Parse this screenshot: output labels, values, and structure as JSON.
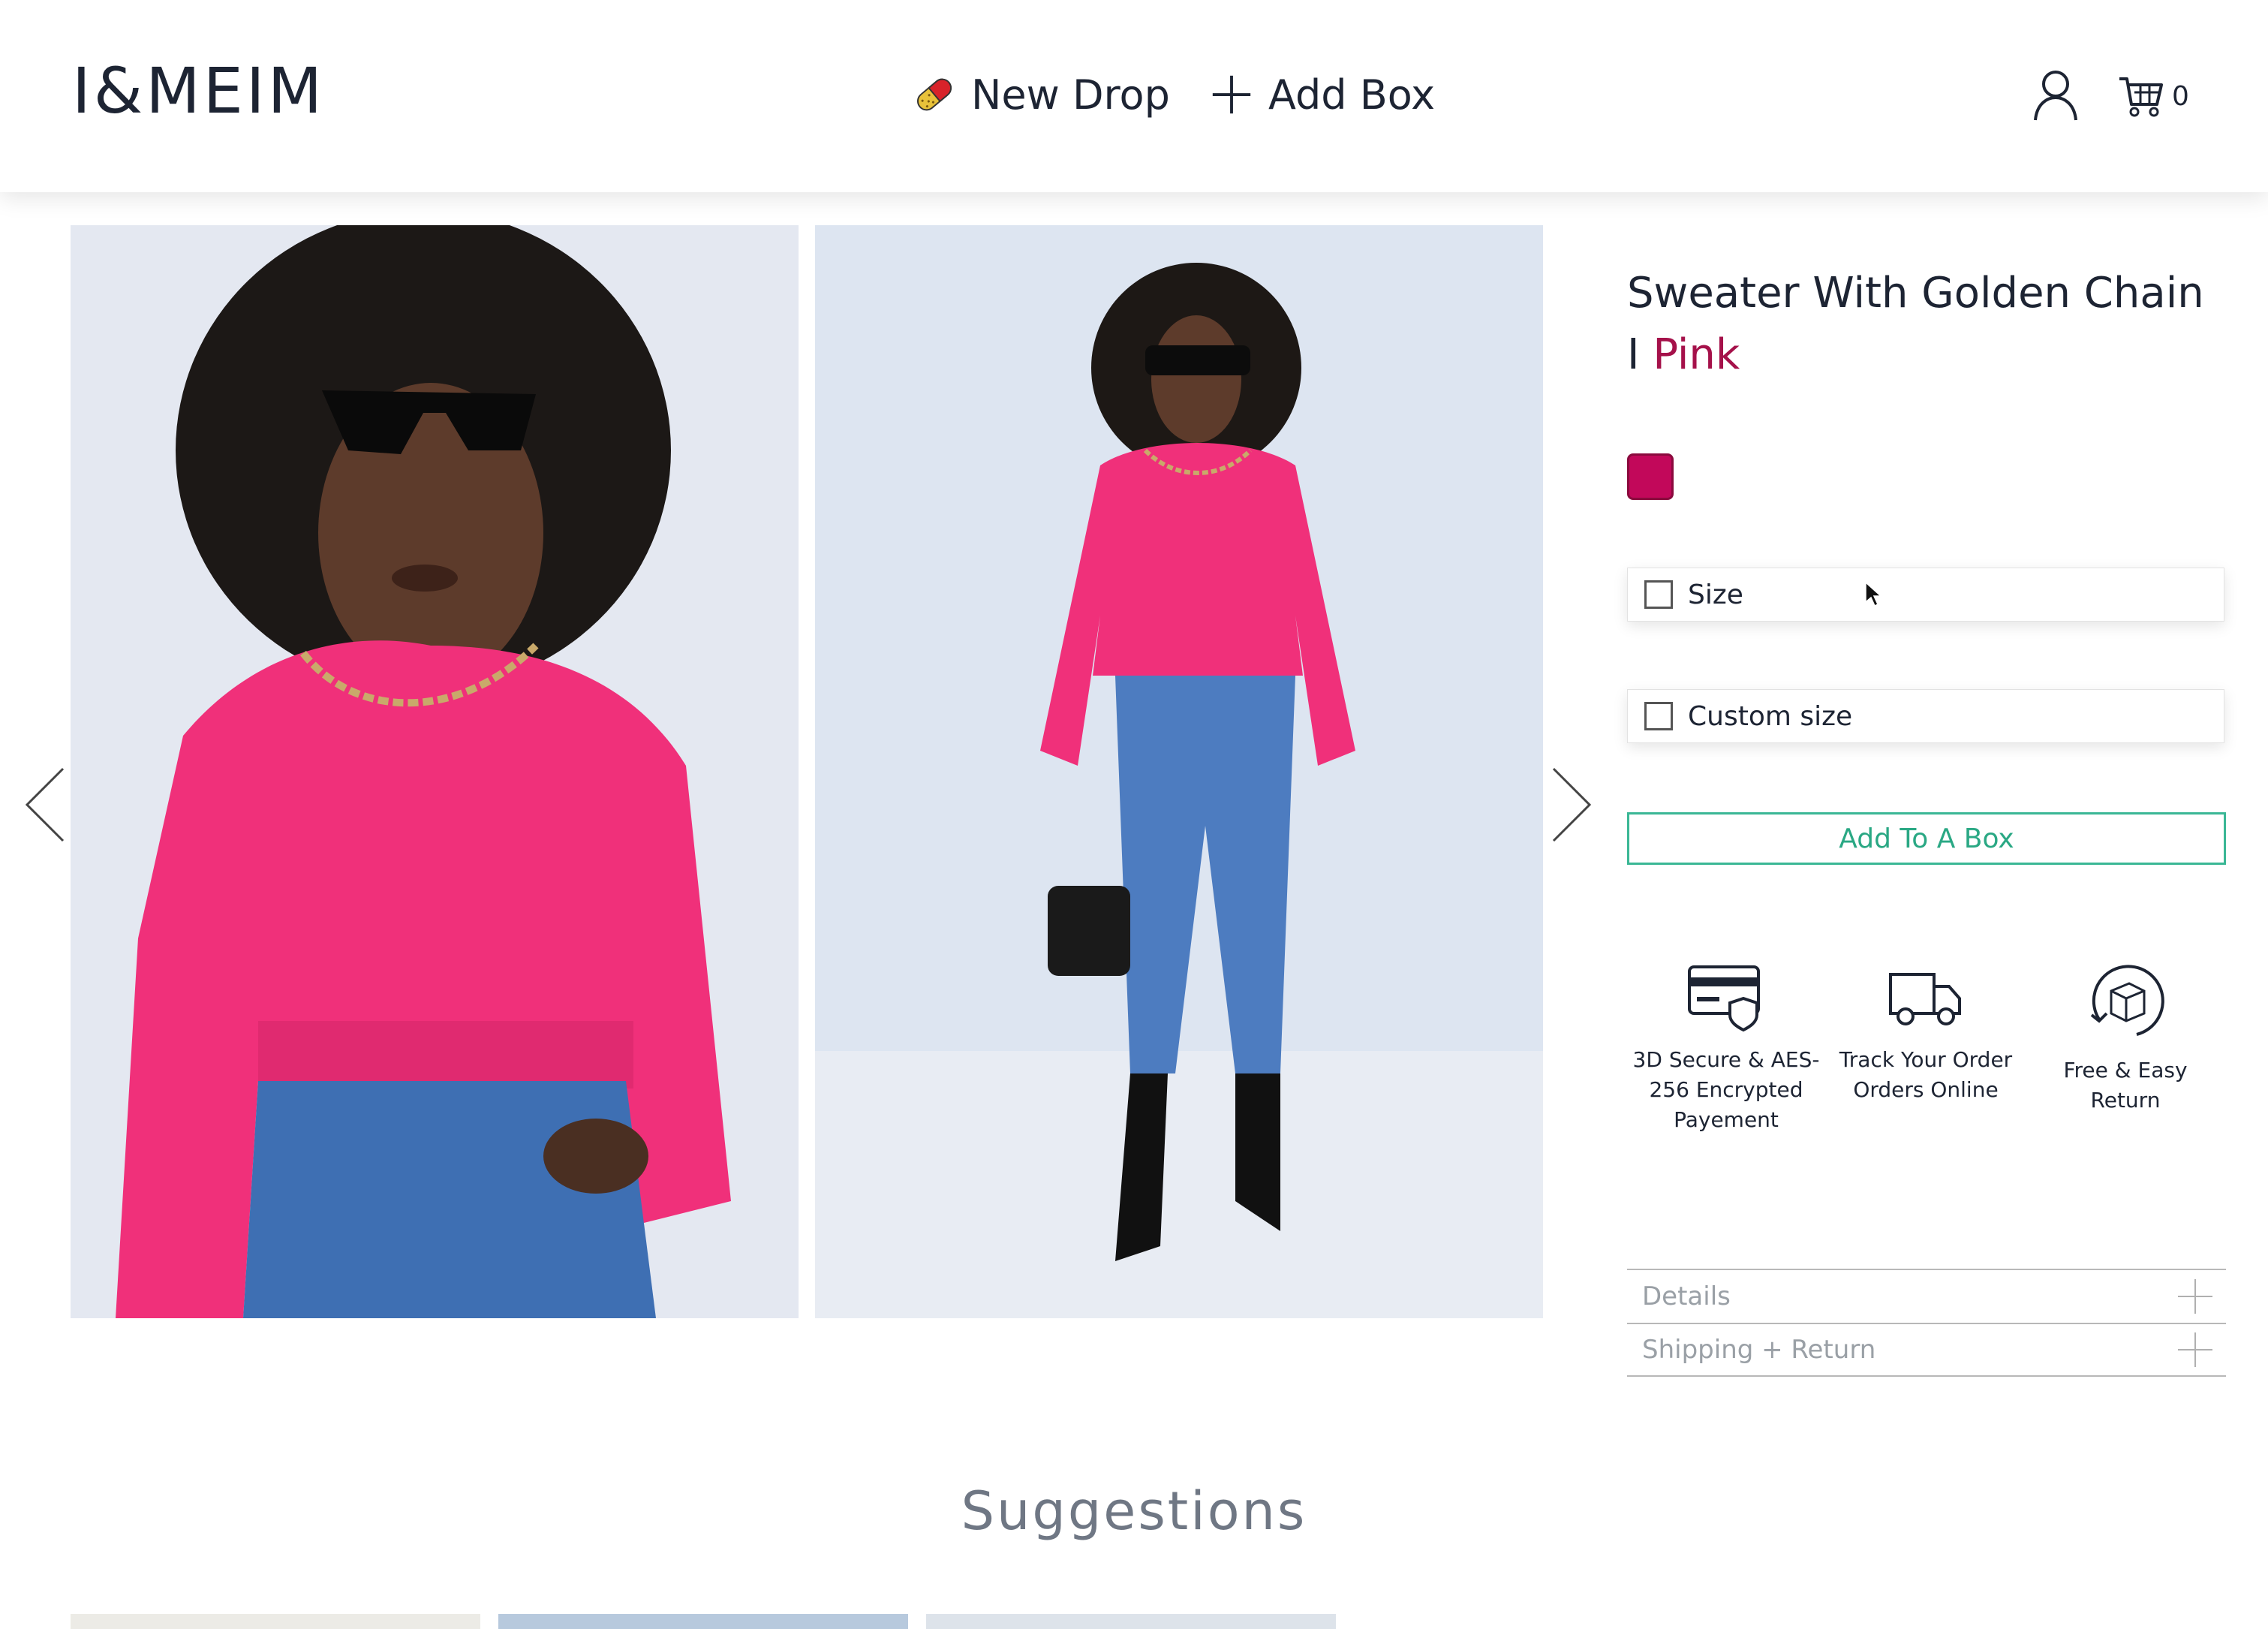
{
  "header": {
    "logo": "I&MEIM",
    "nav": [
      {
        "label": "New Drop",
        "icon": "pill-icon"
      },
      {
        "label": "Add Box",
        "icon": "plus-icon"
      }
    ],
    "account_icon": "user-icon",
    "cart_icon": "cart-icon",
    "cart_count": "0"
  },
  "gallery": {
    "images": [
      "model-closeup-photo",
      "model-full-body-photo"
    ],
    "prev_icon": "chevron-left-icon",
    "next_icon": "chevron-right-icon"
  },
  "product": {
    "title": "Sweater With Golden Chain",
    "title_separator": "I",
    "color_name": "Pink",
    "swatch_color": "#c2085a",
    "options": [
      {
        "label": "Size",
        "checked": false
      },
      {
        "label": "Custom size",
        "checked": false
      }
    ],
    "add_button": "Add To A Box",
    "accent_color": "#3ab795"
  },
  "features": [
    {
      "icon": "secure-card-icon",
      "text": "3D Secure & AES-256 Encrypted Payement"
    },
    {
      "icon": "delivery-truck-icon",
      "text": "Track Your Order Orders Online"
    },
    {
      "icon": "return-box-icon",
      "text": "Free & Easy Return"
    }
  ],
  "accordion": [
    {
      "label": "Details"
    },
    {
      "label": "Shipping + Return"
    }
  ],
  "suggestions": {
    "heading": "Suggestions"
  }
}
